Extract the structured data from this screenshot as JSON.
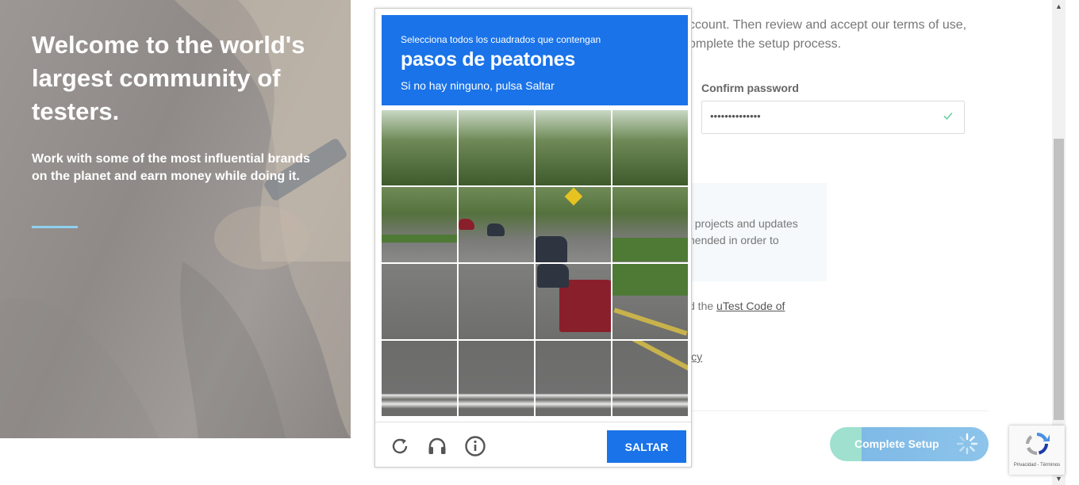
{
  "hero": {
    "title": "Welcome to the world's largest community of testers.",
    "subtitle": "Work with some of the most influential brands on the planet and earn money while doing it."
  },
  "form": {
    "intro_line1": "ccount. Then review and accept our terms of use,",
    "intro_line2": "omplete the setup process.",
    "confirm_password_label": "Confirm password",
    "confirm_password_value": "••••••••••••••",
    "info_text": "t projects and updates nended in order to",
    "code_prefix": "d the ",
    "code_link": "uTest Code of",
    "policy_link": "icy",
    "complete_button": "Complete Setup"
  },
  "captcha": {
    "instruction": "Selecciona todos los cuadrados que contengan",
    "target": "pasos de peatones",
    "hint": "Si no hay ninguno, pulsa Saltar",
    "skip_button": "SALTAR",
    "icons": [
      "reload-icon",
      "audio-icon",
      "info-icon"
    ]
  },
  "recaptcha_badge": {
    "text": "Privacidad - Términos"
  },
  "colors": {
    "captcha_blue": "#1a73e8",
    "hero_rule": "#8fd0ef",
    "valid_check": "#6fcfa0"
  }
}
